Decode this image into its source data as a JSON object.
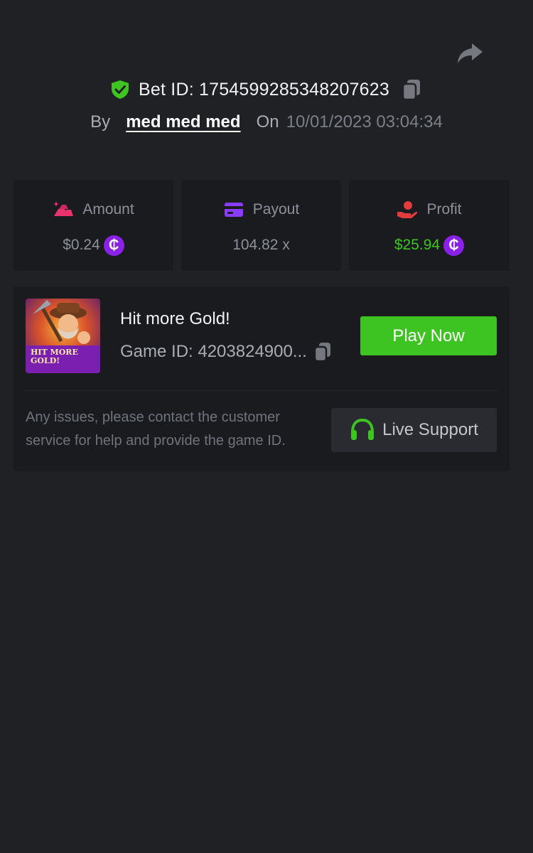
{
  "header": {
    "bet_id_text": "Bet ID: 1754599285348207623",
    "by_label": "By",
    "user_name": "med med med",
    "on_label": "On",
    "date": "10/01/2023 03:04:34"
  },
  "stats": [
    {
      "label": "Amount",
      "value": "$0.24",
      "icon": "gold-bars-icon",
      "has_coin": true,
      "value_color": "#8c9199"
    },
    {
      "label": "Payout",
      "value": "104.82 x",
      "icon": "card-icon",
      "has_coin": false,
      "value_color": "#8c9199"
    },
    {
      "label": "Profit",
      "value": "$25.94",
      "icon": "hand-coin-icon",
      "has_coin": true,
      "value_color": "#3ec422"
    }
  ],
  "coin_symbol": "₵",
  "game": {
    "title": "Hit more Gold!",
    "game_id_text": "Game ID: 4203824900...",
    "thumbnail_title": "HIT MORE GOLD!",
    "play_label": "Play Now"
  },
  "support": {
    "help_text": "Any issues, please contact the customer service for help and provide the game ID.",
    "button_label": "Live Support"
  },
  "colors": {
    "background": "#202125",
    "card": "#1a1b1f",
    "accent_green": "#3ec422",
    "coin_purple": "#8a21e6",
    "amount_pink": "#e8336e",
    "payout_purple": "#8b3dff",
    "profit_red": "#e23b3b"
  }
}
